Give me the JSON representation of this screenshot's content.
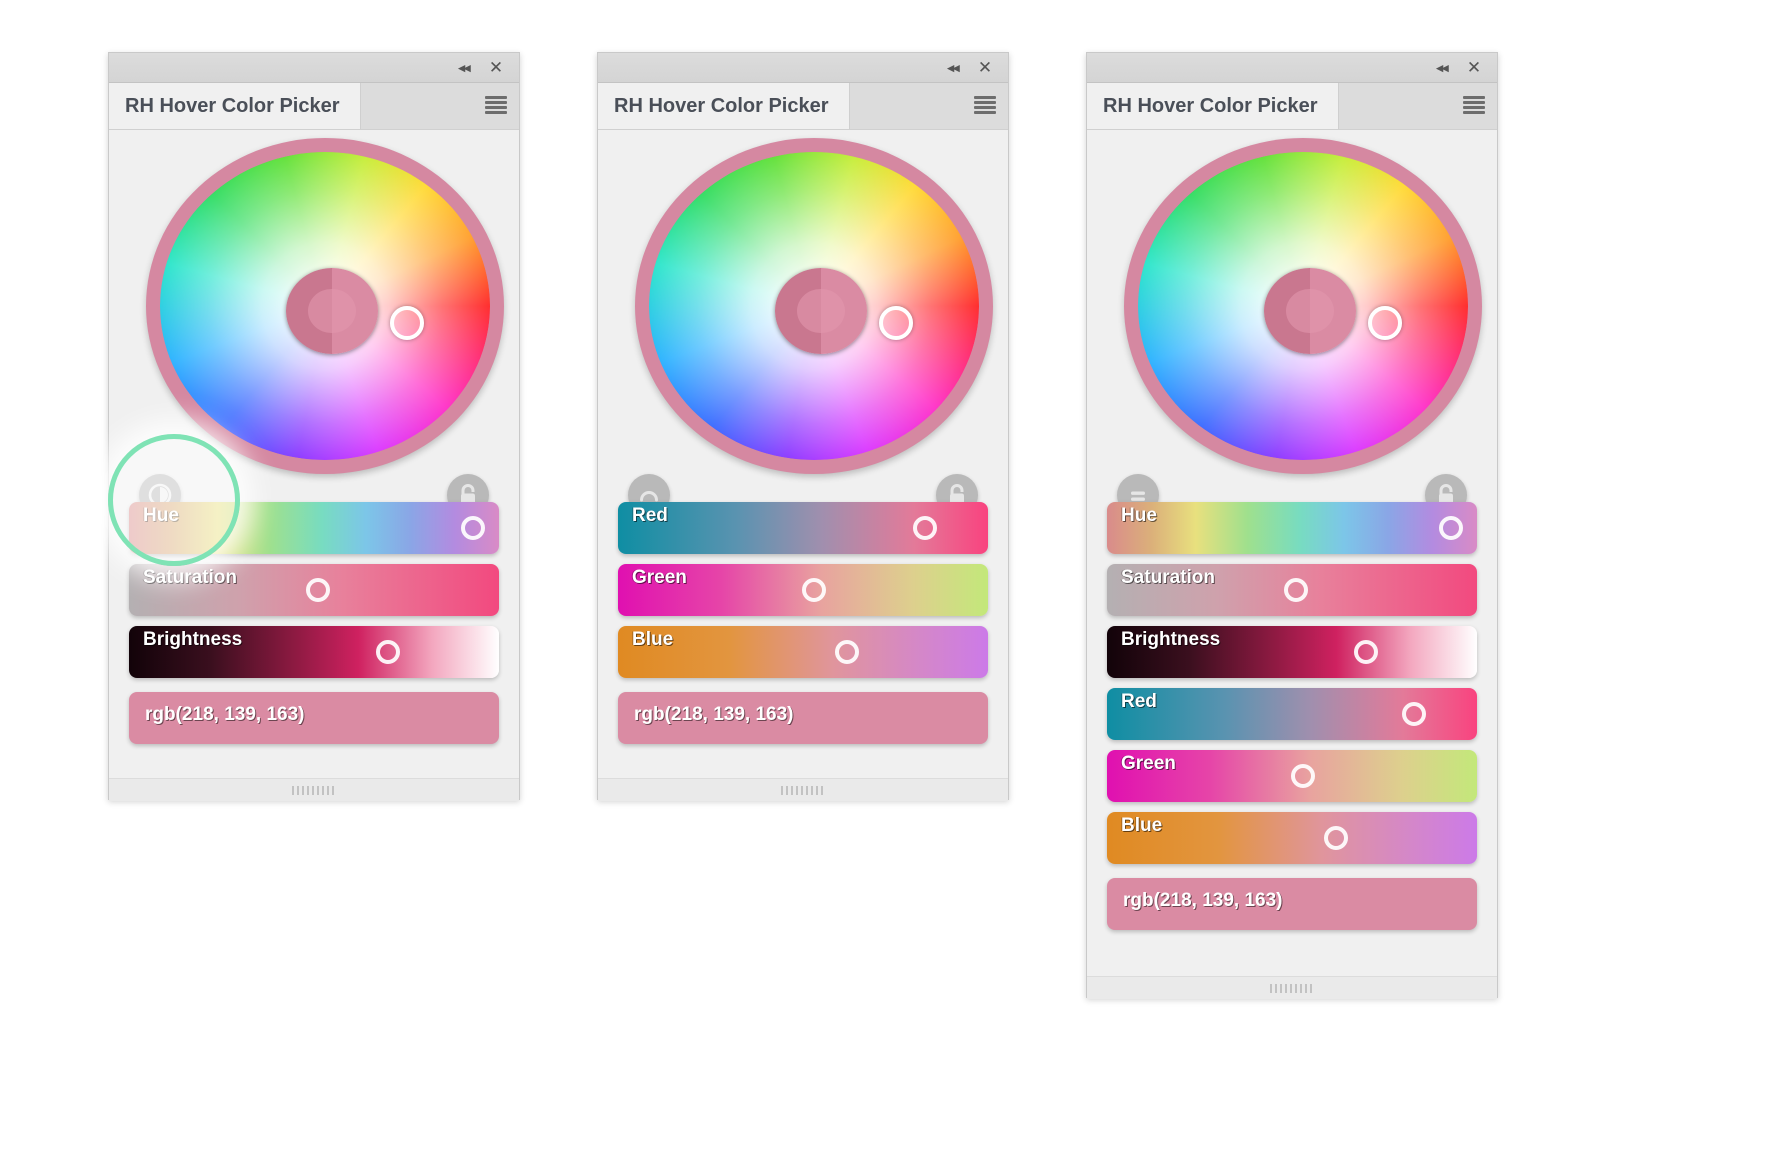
{
  "window": {
    "title": "RH Hover Color Picker",
    "collapse_label": "◂◂",
    "close_label": "✕",
    "menu_icon": "hamburger-icon"
  },
  "color": {
    "rgb_text": "rgb(218, 139, 163)",
    "swatch_current": "#da8ba3",
    "swatch_previous": "#c9778f",
    "accent": "#d588a1",
    "annotation_color": "#7fe3b5"
  },
  "panels": [
    {
      "id": "panel-hsb",
      "title": "RH Hover Color Picker",
      "left_button": "brightness-contrast-icon",
      "right_button": "lock-icon",
      "sliders": [
        {
          "label": "Hue",
          "knob_pct": 93,
          "from": "#d98b8b",
          "mid": "#e8e07e",
          "to": "#b38be0"
        },
        {
          "label": "Saturation",
          "knob_pct": 51,
          "from": "#b4b0b2",
          "to": "#f2497f"
        },
        {
          "label": "Brightness",
          "knob_pct": 70,
          "from": "#120309",
          "mid": "#cf2160",
          "to": "#ffffff"
        }
      ],
      "value": "rgb(218, 139, 163)"
    },
    {
      "id": "panel-rgb",
      "title": "RH Hover Color Picker",
      "left_button": "undo-arc-icon",
      "right_button": "lock-icon",
      "sliders": [
        {
          "label": "Red",
          "knob_pct": 83,
          "from": "#0f8ea3",
          "to": "#f9437f"
        },
        {
          "label": "Green",
          "knob_pct": 53,
          "from": "#e010b0",
          "to": "#c3e87a"
        },
        {
          "label": "Blue",
          "knob_pct": 62,
          "from": "#e08a22",
          "to": "#cc7ae8"
        }
      ],
      "value": "rgb(218, 139, 163)"
    },
    {
      "id": "panel-all",
      "title": "RH Hover Color Picker",
      "left_button": "equals-icon",
      "right_button": "lock-icon",
      "sliders": [
        {
          "label": "Hue",
          "knob_pct": 93,
          "from": "#d98b8b",
          "mid": "#e8e07e",
          "to": "#b38be0"
        },
        {
          "label": "Saturation",
          "knob_pct": 51,
          "from": "#b4b0b2",
          "to": "#f2497f"
        },
        {
          "label": "Brightness",
          "knob_pct": 70,
          "from": "#120309",
          "mid": "#cf2160",
          "to": "#ffffff"
        },
        {
          "label": "Red",
          "knob_pct": 83,
          "from": "#0f8ea3",
          "to": "#f9437f"
        },
        {
          "label": "Green",
          "knob_pct": 53,
          "from": "#e010b0",
          "to": "#c3e87a"
        },
        {
          "label": "Blue",
          "knob_pct": 62,
          "from": "#e08a22",
          "to": "#cc7ae8"
        }
      ],
      "value": "rgb(218, 139, 163)"
    }
  ]
}
